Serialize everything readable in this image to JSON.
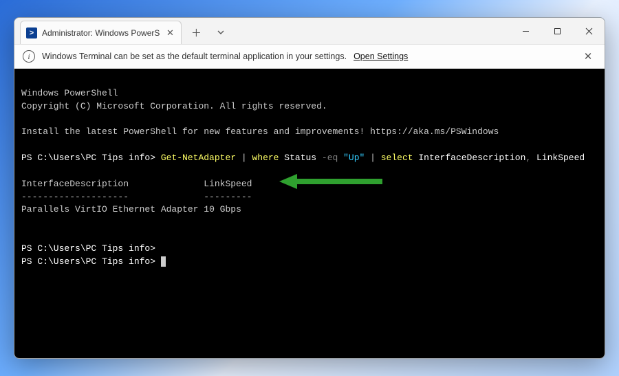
{
  "tab": {
    "title": "Administrator: Windows PowerS",
    "icon_glyph": ">"
  },
  "window_controls": {
    "minimize": "—",
    "maximize": "▢",
    "close": "✕"
  },
  "infobar": {
    "message": "Windows Terminal can be set as the default terminal application in your settings.",
    "link": "Open Settings",
    "close": "✕"
  },
  "terminal": {
    "line1": "Windows PowerShell",
    "line2": "Copyright (C) Microsoft Corporation. All rights reserved.",
    "line3": "Install the latest PowerShell for new features and improvements! https://aka.ms/PSWindows",
    "prompt": "PS C:\\Users\\PC Tips info> ",
    "cmd_part1": "Get-NetAdapter",
    "pipe1": " | ",
    "cmd_part2": "where",
    "cmd_part3": " Status ",
    "op_eq": "-eq",
    "str_up": " \"Up\"",
    "pipe2": " | ",
    "cmd_part4": "select",
    "cmd_part5": " InterfaceDescription",
    "comma": ",",
    "cmd_part6": " LinkSpeed",
    "header1": "InterfaceDescription",
    "header2": "LinkSpeed",
    "divider1": "--------------------",
    "divider2": "---------",
    "row_desc": "Parallels VirtIO Ethernet Adapter",
    "row_speed": "10 Gbps",
    "prompt2": "PS C:\\Users\\PC Tips info>",
    "prompt3": "PS C:\\Users\\PC Tips info> "
  }
}
